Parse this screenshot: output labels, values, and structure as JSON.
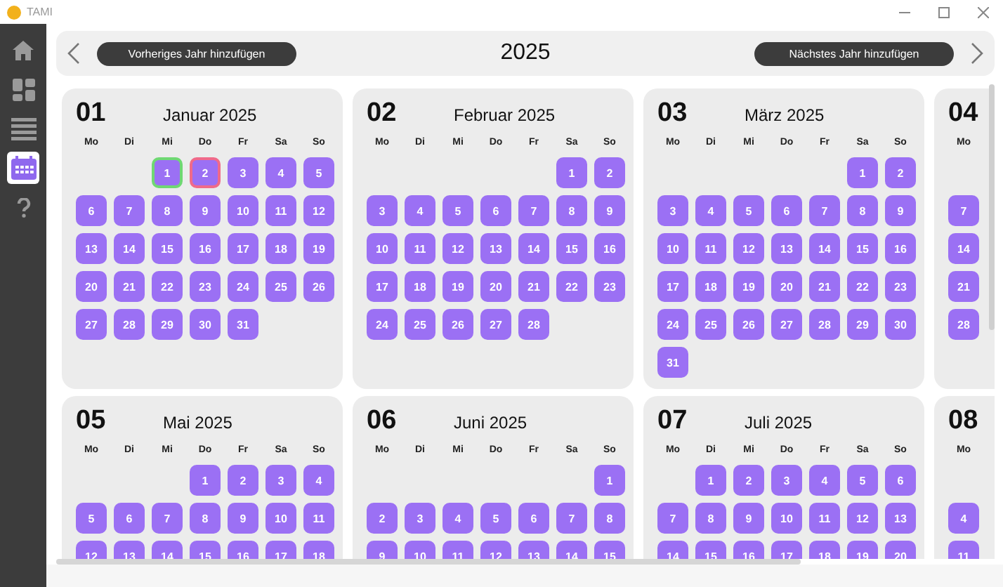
{
  "window": {
    "title": "TAMI"
  },
  "sidebar": {
    "items": [
      {
        "kind": "home",
        "selected": false
      },
      {
        "kind": "dashboard",
        "selected": false
      },
      {
        "kind": "list",
        "selected": false
      },
      {
        "kind": "calendar",
        "selected": true
      },
      {
        "kind": "help",
        "selected": false
      }
    ]
  },
  "header": {
    "prev_button": "Vorheriges Jahr hinzufügen",
    "year": "2025",
    "next_button": "Nächstes Jahr hinzufügen"
  },
  "months": [
    {
      "number": "01",
      "title": "Januar 2025",
      "weekdays": [
        "Mo",
        "Di",
        "Mi",
        "Do",
        "Fr",
        "Sa",
        "So"
      ],
      "weeks": [
        [
          {
            "text": "1",
            "color": "#6fd873"
          },
          {
            "text": "2",
            "color": "#f06a8a"
          },
          "3",
          "4",
          "5"
        ],
        [
          "6",
          "7",
          "8",
          "9",
          "10",
          "11",
          "12"
        ],
        [
          "13",
          "14",
          "15",
          "16",
          "17",
          "18",
          "19"
        ],
        [
          "20",
          "21",
          "22",
          "23",
          "24",
          "25",
          "26"
        ],
        [
          "27",
          "28",
          "29",
          "30",
          "31"
        ]
      ]
    },
    {
      "number": "02",
      "title": "Februar 2025",
      "weekdays": [
        "Mo",
        "Di",
        "Mi",
        "Do",
        "Fr",
        "Sa",
        "So"
      ],
      "weeks": [
        [
          "1",
          "2"
        ],
        [
          "3",
          "4",
          "5",
          "6",
          "7",
          "8",
          "9"
        ],
        [
          "10",
          "11",
          "12",
          "13",
          "14",
          "15",
          "16"
        ],
        [
          "17",
          "18",
          "19",
          "20",
          "21",
          "22",
          "23"
        ],
        [
          "24",
          "25",
          "26",
          "27",
          "28"
        ]
      ]
    },
    {
      "number": "03",
      "title": "März 2025",
      "weekdays": [
        "Mo",
        "Di",
        "Mi",
        "Do",
        "Fr",
        "Sa",
        "So"
      ],
      "weeks": [
        [
          "1",
          "2"
        ],
        [
          "3",
          "4",
          "5",
          "6",
          "7",
          "8",
          "9"
        ],
        [
          "10",
          "11",
          "12",
          "13",
          "14",
          "15",
          "16"
        ],
        [
          "17",
          "18",
          "19",
          "20",
          "21",
          "22",
          "23"
        ],
        [
          "24",
          "25",
          "26",
          "27",
          "28",
          "29",
          "30"
        ],
        [
          "31"
        ]
      ]
    },
    {
      "number": "04",
      "weekdays": [
        "Mo"
      ],
      "blank_first_row": true,
      "weeks": [
        [
          "7"
        ],
        [
          "14"
        ],
        [
          "21"
        ],
        [
          "28"
        ]
      ]
    },
    {
      "number": "05",
      "title": "Mai 2025",
      "weekdays": [
        "Mo",
        "Di",
        "Mi",
        "Do",
        "Fr",
        "Sa",
        "So"
      ],
      "weeks": [
        [
          "1",
          "2",
          "3",
          "4"
        ],
        [
          "5",
          "6",
          "7",
          "8",
          "9",
          "10",
          "11"
        ],
        [
          "12",
          "13",
          "14",
          "15",
          "16",
          "17",
          "18"
        ]
      ]
    },
    {
      "number": "06",
      "title": "Juni 2025",
      "weekdays": [
        "Mo",
        "Di",
        "Mi",
        "Do",
        "Fr",
        "Sa",
        "So"
      ],
      "weeks": [
        [
          "1"
        ],
        [
          "2",
          "3",
          "4",
          "5",
          "6",
          "7",
          "8"
        ],
        [
          "9",
          "10",
          "11",
          "12",
          "13",
          "14",
          "15"
        ]
      ]
    },
    {
      "number": "07",
      "title": "Juli 2025",
      "weekdays": [
        "Mo",
        "Di",
        "Mi",
        "Do",
        "Fr",
        "Sa",
        "So"
      ],
      "weeks": [
        [
          "1",
          "2",
          "3",
          "4",
          "5",
          "6"
        ],
        [
          "7",
          "8",
          "9",
          "10",
          "11",
          "12",
          "13"
        ],
        [
          "14",
          "15",
          "16",
          "17",
          "18",
          "19",
          "20"
        ]
      ]
    },
    {
      "number": "08",
      "weekdays": [
        "Mo"
      ],
      "blank_first_row": true,
      "weeks": [
        [
          "4"
        ],
        [
          "11"
        ]
      ]
    }
  ]
}
